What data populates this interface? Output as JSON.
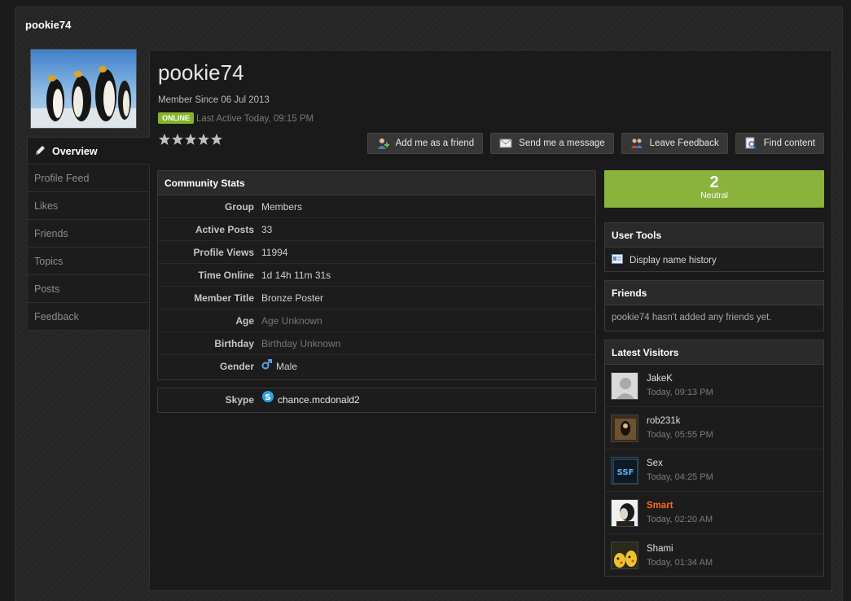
{
  "header": {
    "title": "pookie74"
  },
  "nav": {
    "items": [
      {
        "label": "Overview",
        "active": true
      },
      {
        "label": "Profile Feed"
      },
      {
        "label": "Likes"
      },
      {
        "label": "Friends"
      },
      {
        "label": "Topics"
      },
      {
        "label": "Posts"
      },
      {
        "label": "Feedback"
      }
    ]
  },
  "profile": {
    "username": "pookie74",
    "member_since": "Member Since 06 Jul 2013",
    "status_badge": "ONLINE",
    "last_active": "Last Active Today, 09:15 PM",
    "rating_stars": 5
  },
  "actions": [
    {
      "label": "Add me as a friend",
      "icon": "add-friend-icon"
    },
    {
      "label": "Send me a message",
      "icon": "message-icon"
    },
    {
      "label": "Leave Feedback",
      "icon": "feedback-icon"
    },
    {
      "label": "Find content",
      "icon": "find-content-icon"
    }
  ],
  "community_stats": {
    "title": "Community Stats",
    "rows": [
      {
        "key": "Group",
        "value": "Members"
      },
      {
        "key": "Active Posts",
        "value": "33"
      },
      {
        "key": "Profile Views",
        "value": "11994"
      },
      {
        "key": "Time Online",
        "value": "1d 14h 11m 31s"
      },
      {
        "key": "Member Title",
        "value": "Bronze Poster"
      },
      {
        "key": "Age",
        "value": "Age Unknown"
      },
      {
        "key": "Birthday",
        "value": "Birthday Unknown"
      },
      {
        "key": "Gender",
        "value": "Male"
      }
    ]
  },
  "contact": {
    "skype_label": "Skype",
    "skype_value": "chance.mcdonald2"
  },
  "reputation": {
    "value": "2",
    "label": "Neutral",
    "color": "#8ab33c"
  },
  "user_tools": {
    "title": "User Tools",
    "link": "Display name history"
  },
  "friends": {
    "title": "Friends",
    "empty_text": "pookie74 hasn't added any friends yet."
  },
  "latest_visitors": {
    "title": "Latest Visitors",
    "items": [
      {
        "name": "JakeK",
        "time": "Today, 09:13 PM"
      },
      {
        "name": "rob231k",
        "time": "Today, 05:55 PM"
      },
      {
        "name": "Sex",
        "time": "Today, 04:25 PM"
      },
      {
        "name": "Smart",
        "time": "Today, 02:20 AM",
        "highlight": true
      },
      {
        "name": "Shami",
        "time": "Today, 01:34 AM"
      }
    ]
  },
  "colors": {
    "accent_green": "#86b52a",
    "highlight_orange": "#ff6a1a"
  }
}
